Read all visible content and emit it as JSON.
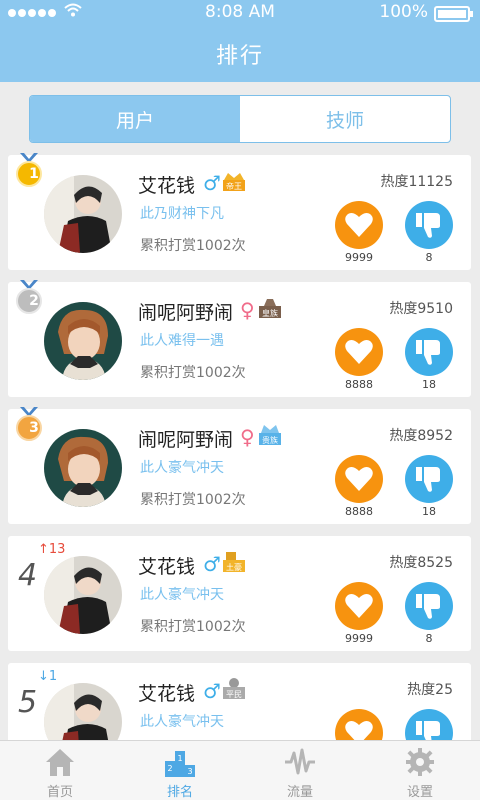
{
  "status_bar": {
    "time": "8:08 AM",
    "battery": "100%"
  },
  "nav": {
    "title": "排行"
  },
  "segments": {
    "users": "用户",
    "technicians": "技师"
  },
  "entries": [
    {
      "rank": "1",
      "name": "艾花钱",
      "gender": "♂",
      "badge_label": "帝王",
      "slogan": "此乃财神下凡",
      "reward": "累积打赏1002次",
      "heat": "热度11125",
      "likes": "9999",
      "dislikes": "8"
    },
    {
      "rank": "2",
      "name": "闹呢阿野闹",
      "gender": "♀",
      "badge_label": "皇族",
      "slogan": "此人难得一遇",
      "reward": "累积打赏1002次",
      "heat": "热度9510",
      "likes": "8888",
      "dislikes": "18"
    },
    {
      "rank": "3",
      "name": "闹呢阿野闹",
      "gender": "♀",
      "badge_label": "贵族",
      "slogan": "此人豪气冲天",
      "reward": "累积打赏1002次",
      "heat": "热度8952",
      "likes": "8888",
      "dislikes": "18"
    },
    {
      "rank": "4",
      "rank_change": "13",
      "rank_direction": "up",
      "name": "艾花钱",
      "gender": "♂",
      "badge_label": "土豪",
      "slogan": "此人豪气冲天",
      "reward": "累积打赏1002次",
      "heat": "热度8525",
      "likes": "9999",
      "dislikes": "8"
    },
    {
      "rank": "5",
      "rank_change": "1",
      "rank_direction": "down",
      "name": "艾花钱",
      "gender": "♂",
      "badge_label": "平民",
      "slogan": "此人豪气冲天",
      "heat": "热度25"
    }
  ],
  "tabs": {
    "home": "首页",
    "ranking": "排名",
    "traffic": "流量",
    "settings": "设置"
  },
  "colors": {
    "primary": "#8cc8ef",
    "like": "#f7930f",
    "dislike": "#3eaee8",
    "male": "#3eaee8",
    "female": "#f06c8a",
    "rank_up": "#e74c3c",
    "rank_down": "#4ea8e4"
  },
  "icons": {
    "like": "heart-icon",
    "dislike": "thumbs-down-icon",
    "home": "home-icon",
    "ranking": "podium-icon",
    "traffic": "waveform-icon",
    "settings": "gear-icon"
  }
}
